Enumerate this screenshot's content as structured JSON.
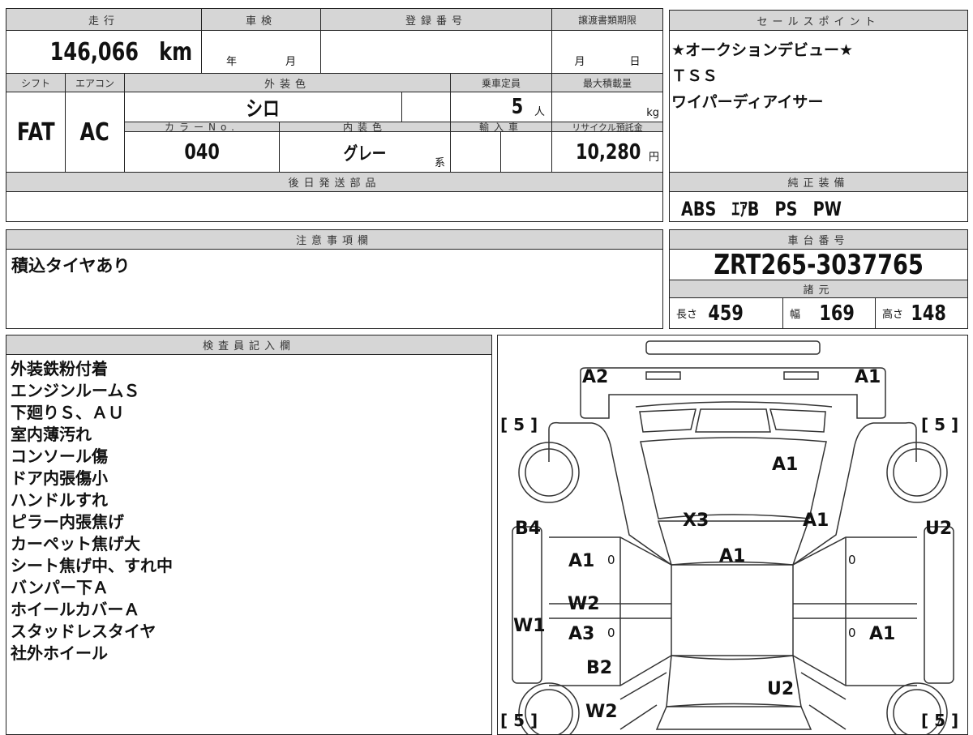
{
  "main": {
    "mileage_h": "走行",
    "shaken_h": "車検",
    "reg_h": "登録番号",
    "transfer_h": "譲渡書類期限",
    "mileage": "146,066",
    "mileage_unit": "km",
    "year": "年",
    "month": "月",
    "t_month": "月",
    "t_day": "日",
    "shift_h": "シフト",
    "ac_h": "エアコン",
    "ext_color_h": "外装色",
    "capacity_h": "乗車定員",
    "maxload_h": "最大積載量",
    "shift": "FAT",
    "ac": "AC",
    "ext_color": "シロ",
    "capacity": "5",
    "capacity_unit": "人",
    "load_unit": "kg",
    "color_no_h": "カラーNo.",
    "int_color_h": "内装色",
    "import_h": "輸入車",
    "recycle_h": "リサイクル預託金",
    "color_no": "040",
    "int_color": "グレー",
    "int_suffix": "系",
    "recycle": "10,280",
    "recycle_unit": "円",
    "parts_h": "後日発送部品"
  },
  "sales": {
    "h": "セールスポイント",
    "lines": [
      "★オークションデビュー★",
      "ＴＳＳ",
      "ワイパーディアイサー"
    ]
  },
  "equip": {
    "h": "純正装備",
    "value": "ABS　ｴｱB　PS　PW"
  },
  "notes": {
    "h": "注意事項欄",
    "text": "積込タイヤあり"
  },
  "chassis": {
    "h": "車台番号",
    "value": "ZRT265-3037765",
    "spec_h": "諸元",
    "len_l": "長さ",
    "len": "459",
    "wid_l": "幅",
    "wid": "169",
    "hgt_l": "高さ",
    "hgt": "148"
  },
  "inspector": {
    "h": "検査員記入欄",
    "lines": [
      "外装鉄粉付着",
      "エンジンルームＳ",
      "下廻りＳ、ＡＵ",
      "室内薄汚れ",
      "コンソール傷",
      "ドア内張傷小",
      "ハンドルすれ",
      "ピラー内張焦げ",
      "カーペット焦げ大",
      "シート焦げ中、すれ中",
      "バンパー下Ａ",
      "ホイールカバーＡ",
      "スタッドレスタイヤ",
      "社外ホイール"
    ]
  },
  "diagram": {
    "labels": [
      "A2",
      "A1",
      "A1",
      "X3",
      "A1",
      "B4",
      "U2",
      "A1",
      "0",
      "A1",
      "0",
      "W2",
      "W1",
      "A3",
      "0",
      "0",
      "A1",
      "B2",
      "U2",
      "W2"
    ],
    "tires": [
      "[ 5 ]",
      "[ 5 ]",
      "[ 5 ]",
      "[ 5 ]"
    ]
  }
}
